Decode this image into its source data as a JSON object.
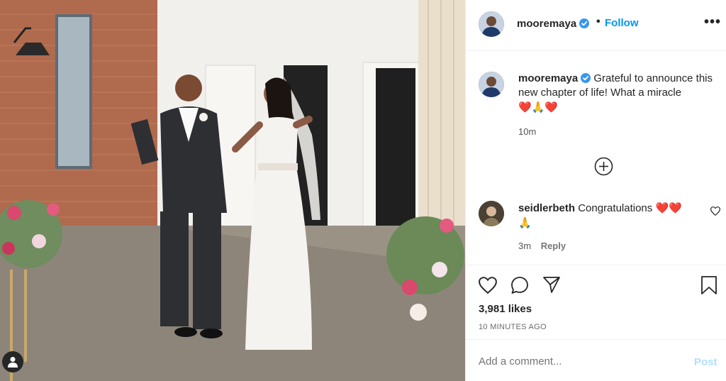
{
  "post": {
    "username": "mooremaya",
    "follow_label": "Follow",
    "separator": "•",
    "more_label": "•••"
  },
  "caption": {
    "username": "mooremaya",
    "text": "Grateful to announce this new chapter of life! What a miracle",
    "emojis": "❤️🙏❤️",
    "time": "10m"
  },
  "comment": {
    "username": "seidlerbeth",
    "text": "Congratulations",
    "emojis_line1": "❤️❤️",
    "emojis_line2": "🙏",
    "time": "3m",
    "reply_label": "Reply"
  },
  "stats": {
    "likes": "3,981 likes",
    "posted": "10 MINUTES AGO"
  },
  "composer": {
    "placeholder": "Add a comment...",
    "post_label": "Post"
  },
  "icons": {
    "verified": "verified-badge-icon",
    "more_comments": "plus-circle-icon",
    "like": "heart-icon",
    "comment": "comment-bubble-icon",
    "share": "paper-plane-icon",
    "save": "bookmark-icon",
    "tags": "user-tag-icon"
  },
  "colors": {
    "link": "#0095f6",
    "post_disabled": "#b2dffc",
    "heart": "#e0245e",
    "verified": "#3897f0"
  }
}
